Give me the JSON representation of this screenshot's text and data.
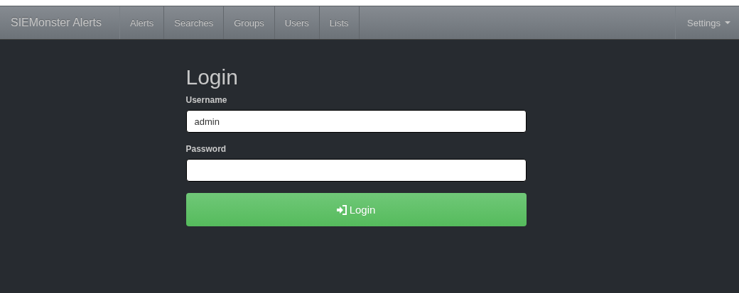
{
  "navbar": {
    "brand": "SIEMonster Alerts",
    "links": [
      {
        "label": "Alerts",
        "selected": false
      },
      {
        "label": "Searches",
        "selected": false
      },
      {
        "label": "Groups",
        "selected": false
      },
      {
        "label": "Users",
        "selected": false
      },
      {
        "label": "Lists",
        "selected": false
      }
    ],
    "settings": "Settings"
  },
  "form": {
    "title": "Login",
    "fields": [
      {
        "label": "Username",
        "value": "admin",
        "kind": "text"
      },
      {
        "label": "Password",
        "kind": "password"
      }
    ],
    "button": "Login"
  }
}
